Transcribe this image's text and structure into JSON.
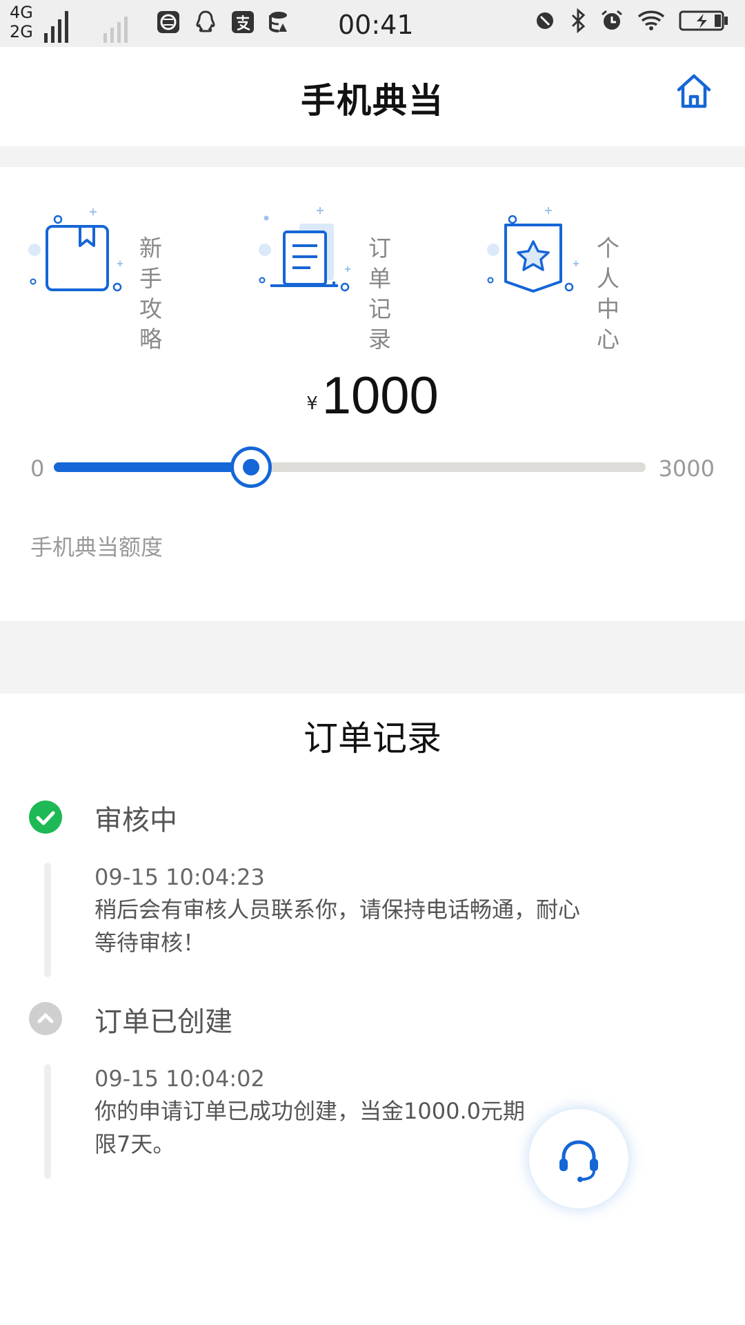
{
  "status_bar": {
    "network_top": "4G",
    "network_bottom": "2G",
    "time": "00:41",
    "app_icons": [
      "browser-icon",
      "qq-icon",
      "alipay-icon",
      "data-icon"
    ],
    "right_icons": [
      "vibrate-icon",
      "bluetooth-icon",
      "alarm-icon",
      "wifi-icon",
      "battery-charging-icon"
    ]
  },
  "header": {
    "title": "手机典当",
    "home_icon": "home-icon",
    "accent": "#1566d6"
  },
  "shortcuts": [
    {
      "label": "新手攻略",
      "icon": "guide-book-icon"
    },
    {
      "label": "订单记录",
      "icon": "order-records-icon"
    },
    {
      "label": "个人中心",
      "icon": "user-center-icon"
    }
  ],
  "amount": {
    "currency": "¥",
    "value": "1000",
    "min": "0",
    "max": "3000",
    "slider_value": 1000,
    "label": "手机典当额度"
  },
  "order_record": {
    "title": "订单记录",
    "events": [
      {
        "status": "审核中",
        "time": "09-15 10:04:23",
        "desc": "稍后会有审核人员联系你，请保持电话畅通，耐心等待审核！",
        "icon": "check-circle-icon",
        "color": "#1db954"
      },
      {
        "status": "订单已创建",
        "time": "09-15 10:04:02",
        "desc": "你的申请订单已成功创建，当金1000.0元期限7天。",
        "icon": "chevron-up-circle-icon",
        "color": "#cfcfcf"
      }
    ]
  },
  "support": {
    "icon": "headset-icon"
  }
}
